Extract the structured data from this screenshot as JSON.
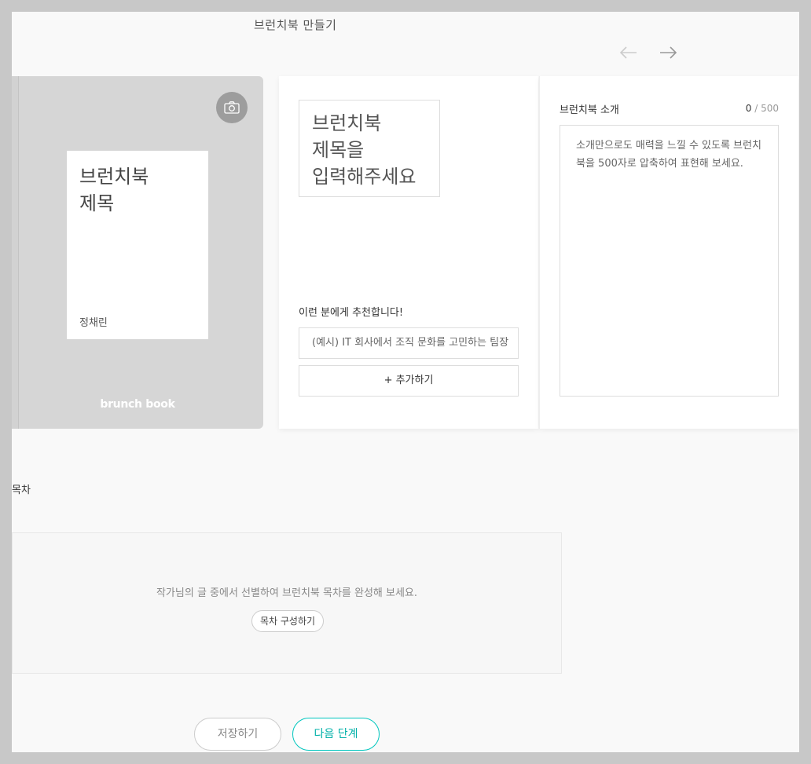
{
  "page": {
    "title": "브런치북 만들기"
  },
  "cover": {
    "title": "브런치북\n제목",
    "author": "정채린",
    "logo": "brunch book"
  },
  "editor": {
    "title_placeholder": "브런치북\n제목을\n입력해주세요",
    "recommend_label": "이런 분에게 추천합니다!",
    "recommend_placeholder": "(예시) IT 회사에서 조직 문화를 고민하는 팀장",
    "add_label": "+ 추가하기"
  },
  "intro": {
    "label": "브런치북 소개",
    "count_current": "0",
    "count_max": " / 500",
    "placeholder": "소개만으로도 매력을 느낄 수 있도록 브런치북을 500자로 압축하여 표현해 보세요."
  },
  "toc": {
    "label": "목차",
    "message": "작가님의 글 중에서 선별하여 브런치북 목차를 완성해 보세요.",
    "build_label": "목차 구성하기"
  },
  "actions": {
    "save_label": "저장하기",
    "next_label": "다음 단계"
  },
  "colors": {
    "accent": "#00c6be",
    "cover_bg": "#d6d6d6",
    "camera_btn": "#9d9d9d"
  },
  "icons": {
    "prev": "arrow-left-icon",
    "next": "arrow-right-icon",
    "camera": "camera-icon"
  }
}
